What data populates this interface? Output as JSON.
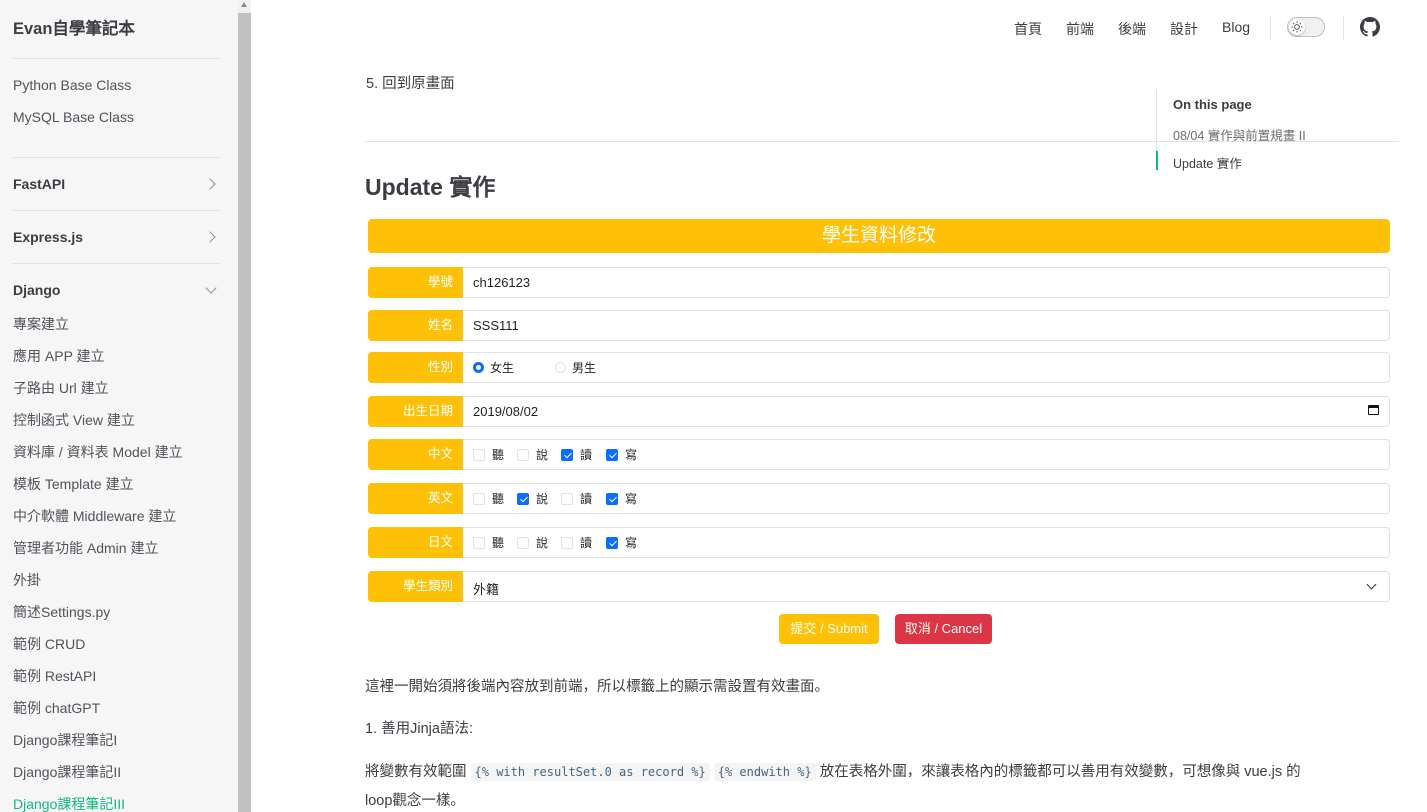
{
  "sidebar": {
    "brand": "Evan自學筆記本",
    "top_links": [
      "Python Base Class",
      "MySQL Base Class"
    ],
    "groups": [
      {
        "label": "FastAPI",
        "expanded": false
      },
      {
        "label": "Express.js",
        "expanded": false
      },
      {
        "label": "Django",
        "expanded": true
      }
    ],
    "django_items": [
      "專案建立",
      "應用 APP 建立",
      "子路由 Url 建立",
      "控制函式 View 建立",
      "資料庫 / 資料表 Model 建立",
      "模板 Template 建立",
      "中介軟體 Middleware 建立",
      "管理者功能 Admin 建立",
      "外掛",
      "簡述Settings.py",
      "範例 CRUD",
      "範例 RestAPI",
      "範例 chatGPT",
      "Django課程筆記I",
      "Django課程筆記II",
      "Django課程筆記III"
    ],
    "active_item": "Django課程筆記III"
  },
  "nav": {
    "items": [
      "首頁",
      "前端",
      "後端",
      "設計",
      "Blog"
    ],
    "theme_toggle": "light",
    "github_icon": "github-icon"
  },
  "content": {
    "step5": "5. 回到原畫面",
    "heading": "Update 實作",
    "toc": {
      "title": "On this page",
      "items": [
        "08/04 實作與前置規畫 II",
        "Update 實作"
      ]
    },
    "form": {
      "title": "學生資料修改",
      "id_label": "學號",
      "id_value": "ch126123",
      "name_label": "姓名",
      "name_value": "SSS111",
      "gender_label": "性別",
      "gender_options": [
        {
          "label": "女生",
          "checked": true
        },
        {
          "label": "男生",
          "checked": false
        }
      ],
      "birth_label": "出生日期",
      "birth_value": "2019/08/02",
      "languages": [
        {
          "label": "中文",
          "skills": [
            {
              "label": "聽",
              "checked": false
            },
            {
              "label": "說",
              "checked": false
            },
            {
              "label": "讀",
              "checked": true
            },
            {
              "label": "寫",
              "checked": true
            }
          ]
        },
        {
          "label": "英文",
          "skills": [
            {
              "label": "聽",
              "checked": false
            },
            {
              "label": "說",
              "checked": true
            },
            {
              "label": "讀",
              "checked": false
            },
            {
              "label": "寫",
              "checked": true
            }
          ]
        },
        {
          "label": "日文",
          "skills": [
            {
              "label": "聽",
              "checked": false
            },
            {
              "label": "說",
              "checked": false
            },
            {
              "label": "讀",
              "checked": false
            },
            {
              "label": "寫",
              "checked": true
            }
          ]
        }
      ],
      "category_label": "學生類別",
      "category_value": "外籍",
      "submit_label": "提交 / Submit",
      "cancel_label": "取消 / Cancel"
    },
    "para1": "這裡一開始須將後端內容放到前端，所以標籤上的顯示需設置有效畫面。",
    "para2": "1. 善用Jinja語法:",
    "para3": {
      "before": "將變數有效範圍 ",
      "code1": "{% with resultSet.0 as record %}",
      "mid": " ",
      "code2": "{% endwith %}",
      "after": " 放在表格外圍，來讓表格內的標籤都可以善用有效變數，可想像與 vue.js 的"
    },
    "para4": "loop觀念一樣。"
  },
  "colors": {
    "accent_green": "#10b981",
    "form_yellow": "#ffc107",
    "cancel_red": "#dc3545",
    "check_blue": "#0d6efd"
  }
}
